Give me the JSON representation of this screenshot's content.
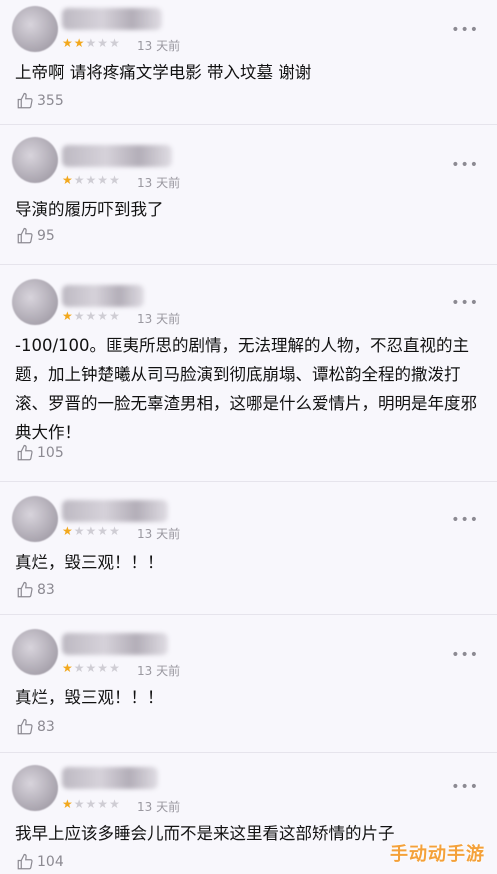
{
  "reviews": [
    {
      "stars_filled": 2,
      "stars_total": 5,
      "time": "13 天前",
      "content": "上帝啊 请将疼痛文学电影 带入坟墓 谢谢",
      "likes": "355"
    },
    {
      "stars_filled": 1,
      "stars_total": 5,
      "time": "13 天前",
      "content": "导演的履历吓到我了",
      "likes": "95"
    },
    {
      "stars_filled": 1,
      "stars_total": 5,
      "time": "13 天前",
      "content": "-100/100。匪夷所思的剧情，无法理解的人物，不忍直视的主题，加上钟楚曦从司马脸演到彻底崩塌、谭松韵全程的撒泼打滚、罗晋的一脸无辜渣男相，这哪是什么爱情片，明明是年度邪典大作！",
      "likes": "105"
    },
    {
      "stars_filled": 1,
      "stars_total": 5,
      "time": "13 天前",
      "content": "真烂，毁三观！！！",
      "likes": "83"
    },
    {
      "stars_filled": 1,
      "stars_total": 5,
      "time": "13 天前",
      "content": "真烂，毁三观！！！",
      "likes": "83"
    },
    {
      "stars_filled": 1,
      "stars_total": 5,
      "time": "13 天前",
      "content": "我早上应该多睡会儿而不是来这里看这部矫情的片子",
      "likes": "104"
    }
  ],
  "more_icon": "more-dots-icon",
  "like_icon": "thumbs-up-icon",
  "watermark": "手动动手游",
  "colors": {
    "star": "#f2a81d",
    "star_empty": "#cfcdd4",
    "watermark": "#f4a13a"
  }
}
